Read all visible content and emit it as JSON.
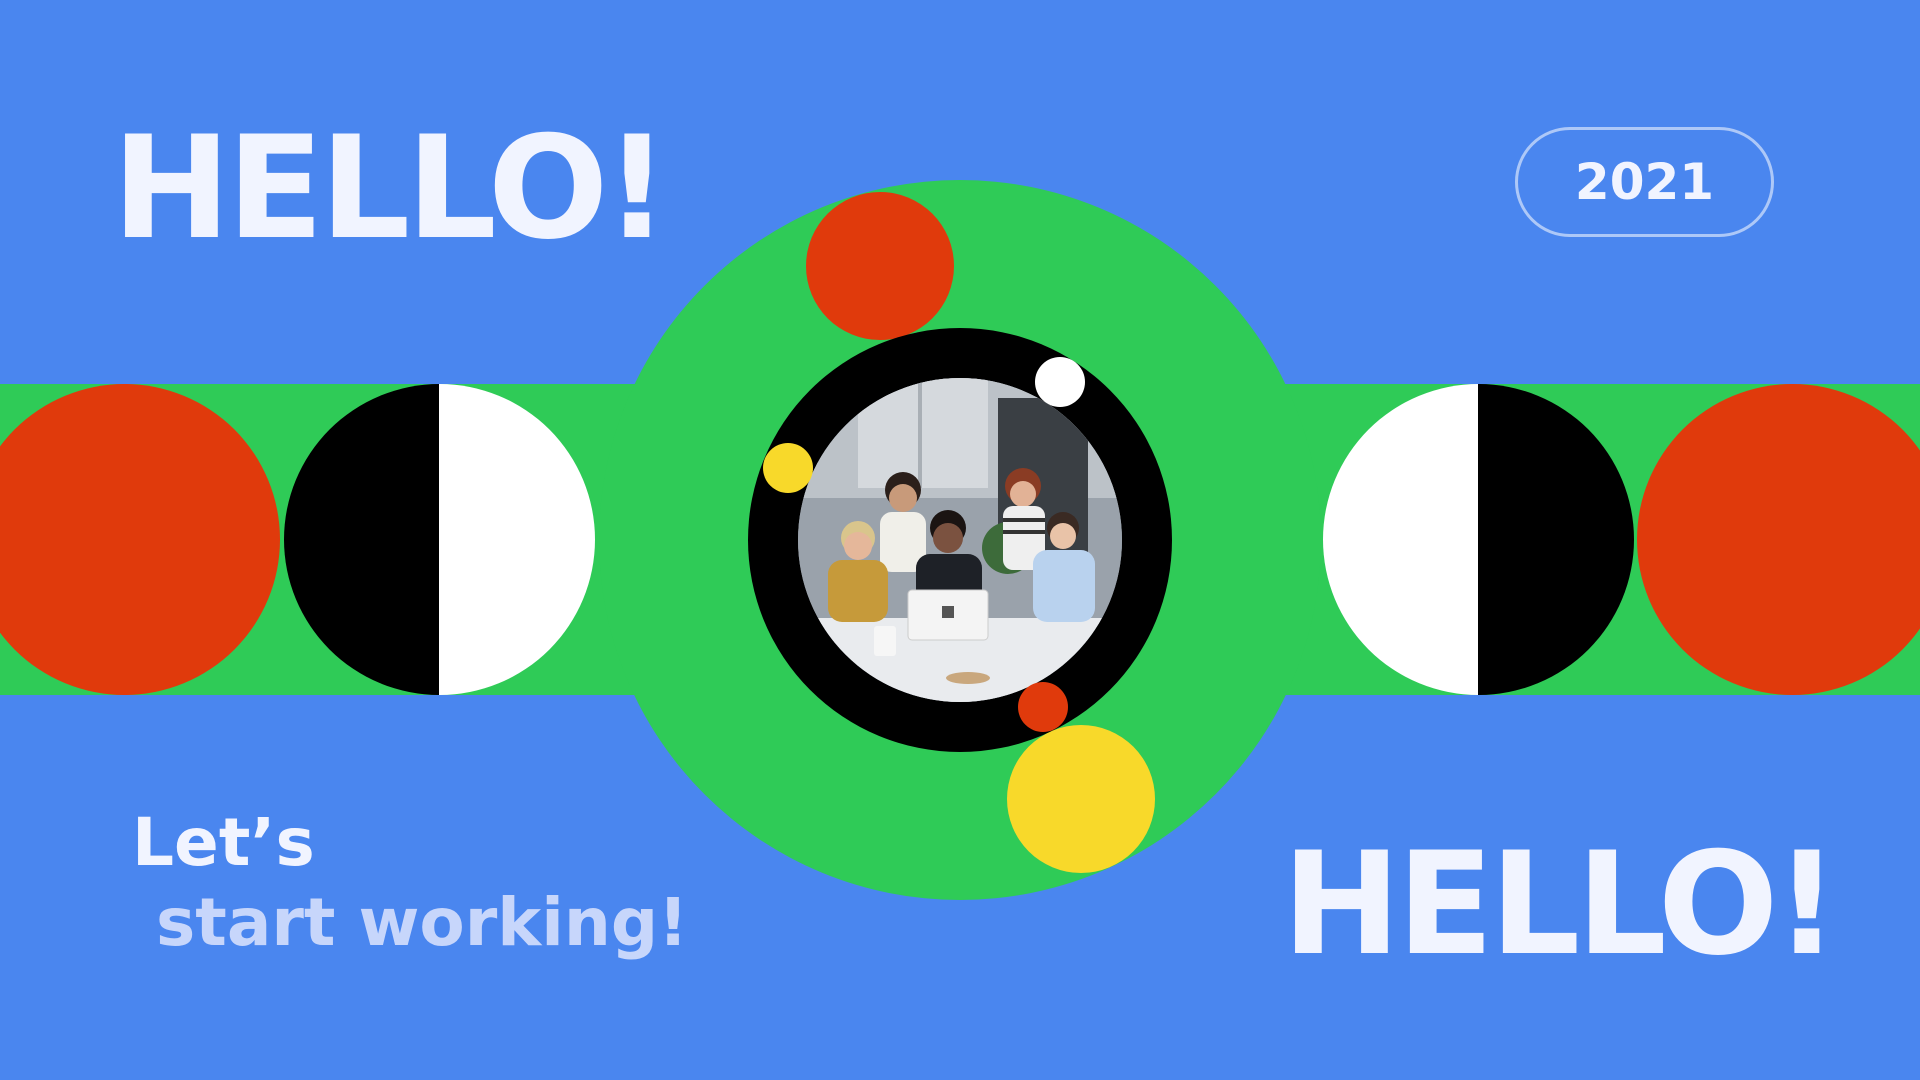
{
  "colors": {
    "background": "#4A86EF",
    "band_green": "#2FCB57",
    "red": "#E03A0C",
    "yellow": "#F8D92A",
    "black": "#000000",
    "white": "#FFFFFF",
    "headline_text": "#F1F4FF",
    "tagline_secondary": "#C7D6FB"
  },
  "headline_top": {
    "text": "HELLO!"
  },
  "headline_bottom": {
    "text": "HELLO!"
  },
  "year_badge": {
    "text": "2021"
  },
  "tagline": {
    "line1": "Let’s",
    "line2": "start working!"
  },
  "photo": {
    "icon": "group-photo-icon",
    "description_hidden": true
  }
}
